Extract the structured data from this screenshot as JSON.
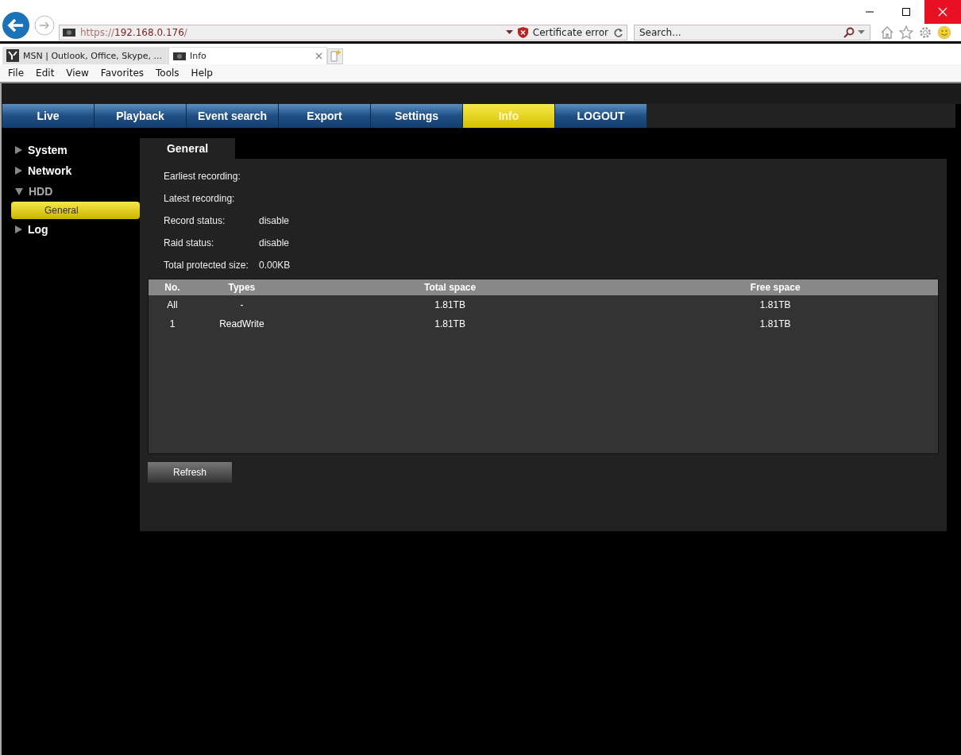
{
  "browser": {
    "address": {
      "scheme": "https://",
      "host": "192.168.0.176",
      "path": "/"
    },
    "certificate": "Certificate error",
    "search": {
      "placeholder": "Search..."
    },
    "tabs": [
      {
        "label": "MSN | Outlook, Office, Skype, ...",
        "selected": false
      },
      {
        "label": "Info",
        "selected": true
      }
    ],
    "menu": [
      "File",
      "Edit",
      "View",
      "Favorites",
      "Tools",
      "Help"
    ]
  },
  "nav": [
    {
      "label": "Live",
      "selected": false
    },
    {
      "label": "Playback",
      "selected": false
    },
    {
      "label": "Event search",
      "selected": false
    },
    {
      "label": "Export",
      "selected": false
    },
    {
      "label": "Settings",
      "selected": false
    },
    {
      "label": "Info",
      "selected": true
    },
    {
      "label": "LOGOUT",
      "selected": false
    }
  ],
  "sidebar": {
    "items": [
      {
        "label": "System",
        "expanded": false
      },
      {
        "label": "Network",
        "expanded": false
      },
      {
        "label": "HDD",
        "expanded": true,
        "children": [
          {
            "label": "General",
            "selected": true
          }
        ]
      },
      {
        "label": "Log",
        "expanded": false
      }
    ]
  },
  "panel": {
    "tab": "General",
    "fields": [
      {
        "label": "Earliest recording:"
      },
      {
        "label": "Latest recording:"
      },
      {
        "label": "Record status:",
        "value": "disable"
      },
      {
        "label": "Raid status:",
        "value": "disable"
      },
      {
        "label": "Total protected size:",
        "value": "0.00KB"
      }
    ],
    "table": {
      "columns": [
        "No.",
        "Types",
        "Total space",
        "Free space"
      ],
      "rows": [
        [
          "All",
          "-",
          "1.81TB",
          "1.81TB"
        ],
        [
          "1",
          "ReadWrite",
          "1.81TB",
          "1.81TB"
        ]
      ]
    },
    "button": "Refresh"
  }
}
